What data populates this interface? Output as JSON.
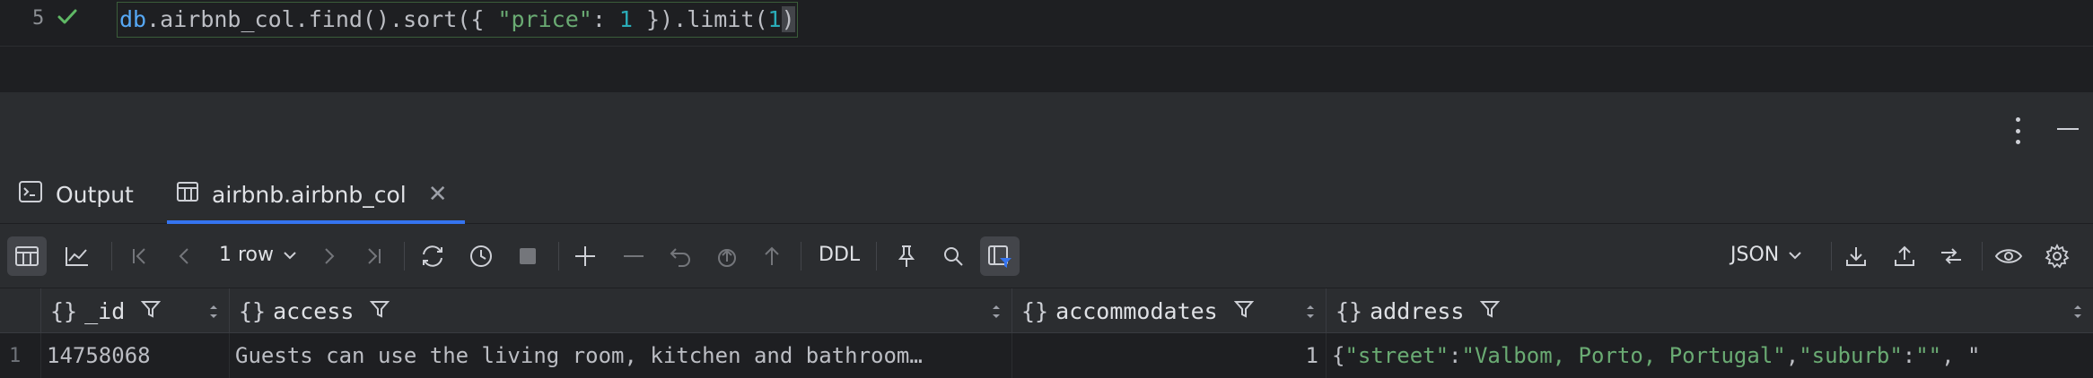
{
  "editor": {
    "line_number": "5",
    "code": {
      "db": "db",
      "mid": ".airbnb_col.find().sort({ ",
      "str": "\"price\"",
      "colon": ": ",
      "num": "1",
      "close": " }).limit(",
      "arg": "1",
      "end": ")"
    }
  },
  "tabs": {
    "output_label": "Output",
    "active_label": "airbnb.airbnb_col"
  },
  "toolbar": {
    "rows_label": "1 row",
    "ddl_label": "DDL",
    "format_label": "JSON"
  },
  "grid": {
    "columns": [
      "_id",
      "access",
      "accommodates",
      "address"
    ],
    "rows": [
      {
        "num": "1",
        "id": "14758068",
        "access": "Guests can use the living room, kitchen and bathroom…",
        "accommodates": "1",
        "address_prefix": "{",
        "address_key1": "\"street\"",
        "address_sep1": ": ",
        "address_val1": "\"Valbom, Porto, Portugal\"",
        "address_sep2": ", ",
        "address_key2": "\"suburb\"",
        "address_sep3": ": ",
        "address_val2": "\"\"",
        "address_tail": ", \""
      }
    ]
  },
  "colors": {
    "accent": "#3574f0",
    "string": "#6aab73",
    "number": "#2aacb8",
    "keyword": "#56a8f5",
    "success": "#5fb865"
  }
}
